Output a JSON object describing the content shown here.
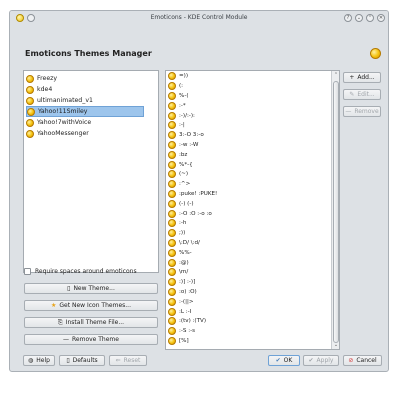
{
  "window": {
    "title": "Emoticons - KDE Control Module",
    "heading": "Emoticons Themes Manager",
    "titlebar_buttons": [
      "?",
      "⌄",
      "⌃",
      "✕"
    ]
  },
  "themes": [
    {
      "label": "Freezy",
      "selected": false
    },
    {
      "label": "kde4",
      "selected": false
    },
    {
      "label": "ultimanimated_v1",
      "selected": false
    },
    {
      "label": "Yahoo!11Smiley",
      "selected": true
    },
    {
      "label": "Yahoo!7withVoice",
      "selected": false
    },
    {
      "label": "YahooMessenger",
      "selected": false
    }
  ],
  "emoticons": [
    "=))",
    "(:",
    "%-(",
    ":-*",
    ":-)/:-):",
    ":-|",
    "3:-O 3:-o",
    ":-w :-W",
    ":bz",
    "%*-{",
    "(~)",
    ":^>",
    ":puke! :PUKE!",
    "(-) (-)",
    ":-O :O :-o :o",
    ":-h",
    ";))",
    "\\:D/ \\:d/",
    "%%-",
    ":@)",
    "\\m/",
    ":)] :-)]",
    ":o) :O)",
    ":-(||>",
    ":L :-I",
    ":(tv) :(TV)",
    ":-S :-s",
    "[%]"
  ],
  "side_buttons": {
    "add": "Add...",
    "edit": "Edit...",
    "remove": "Remove"
  },
  "require_spaces_label": "Require spaces around emoticons",
  "theme_buttons": {
    "new_theme": "New Theme...",
    "get_new": "Get New Icon Themes...",
    "install": "Install Theme File...",
    "remove_theme": "Remove Theme"
  },
  "bottom_buttons": {
    "help": "Help",
    "defaults": "Defaults",
    "reset": "Reset",
    "ok": "OK",
    "apply": "Apply",
    "cancel": "Cancel"
  },
  "colors": {
    "selection": "#9dc5ec",
    "window_bg": "#dde1e5",
    "cancel_icon": "#d23b3b"
  }
}
